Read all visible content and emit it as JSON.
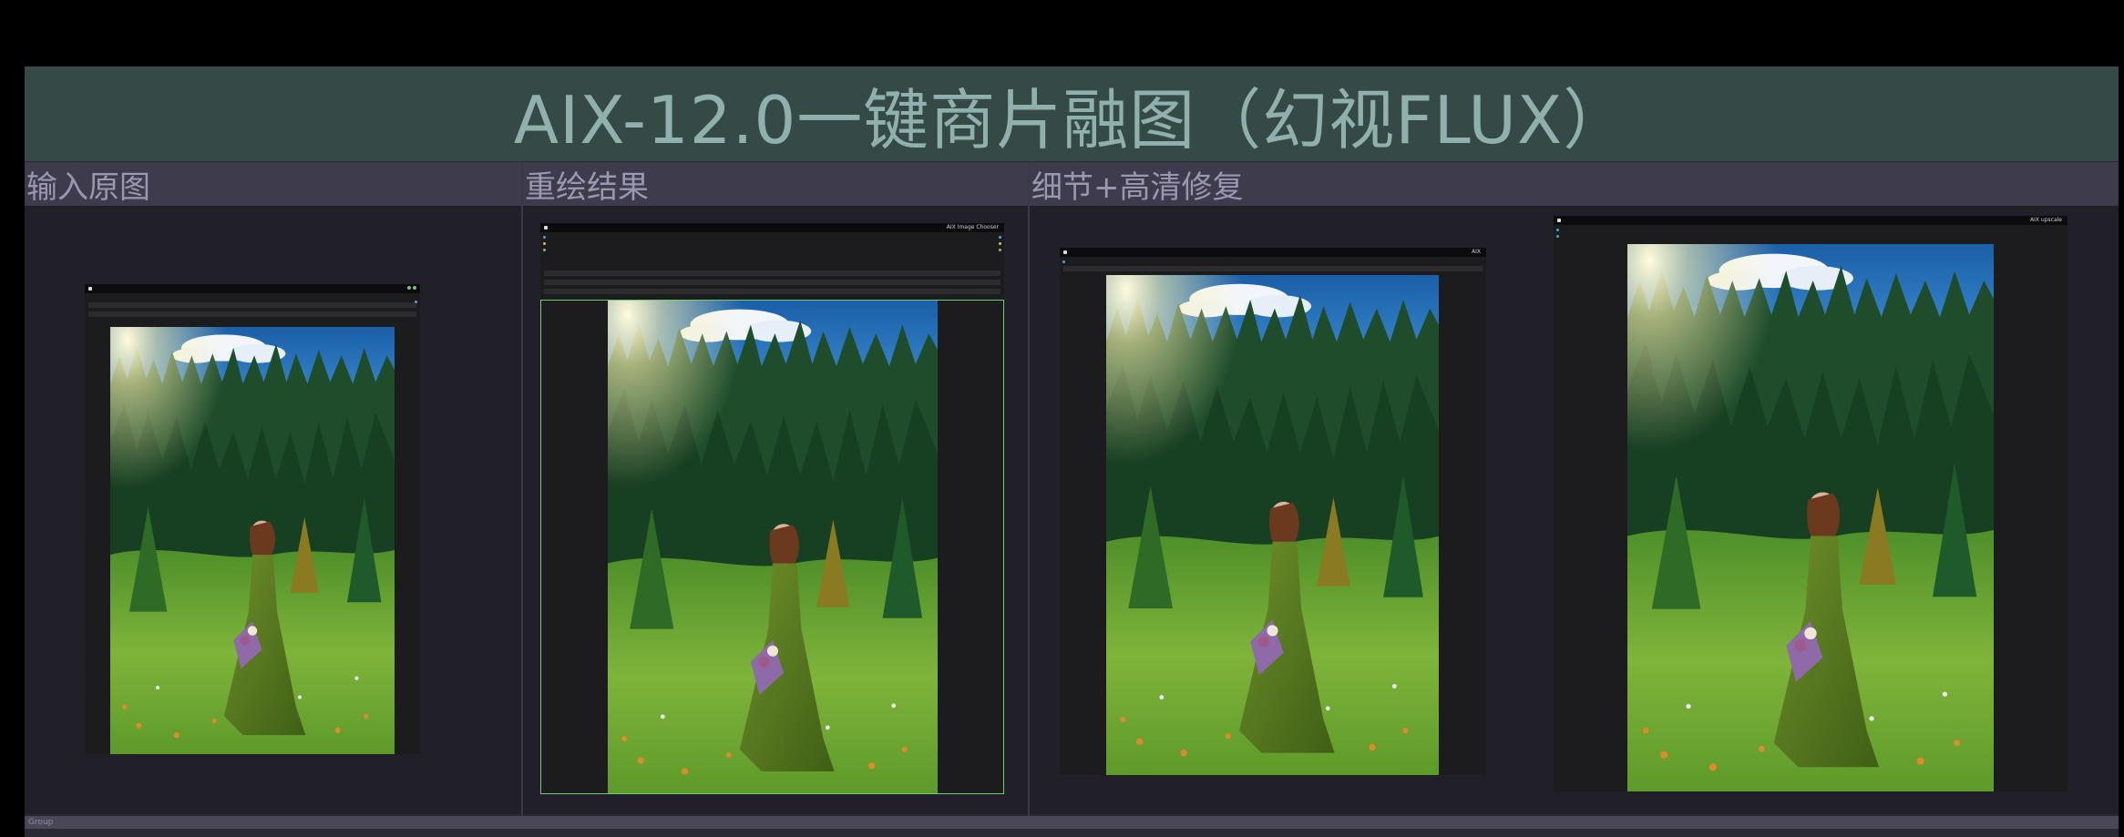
{
  "header": {
    "title": "AIX-12.0一键商片融图（幻视FLUX）"
  },
  "sections": [
    {
      "label": "输入原图"
    },
    {
      "label": "重绘结果"
    },
    {
      "label": "细节+高清修复"
    }
  ],
  "nodes": {
    "input_preview": {
      "header_label": ""
    },
    "redraw_preview": {
      "header_label": "AIX Image Chooser"
    },
    "detail_preview_1": {
      "header_label": "AIX"
    },
    "detail_preview_2": {
      "header_label": "AIX upscale"
    }
  },
  "footer": {
    "group_label": "Group"
  },
  "colors": {
    "background": "#000000",
    "title_bar": "#354a47",
    "title_text": "#8fb0ad",
    "section_header": "#3d3b4c",
    "section_text": "#9a98b0",
    "panel": "#212028",
    "node": "#1c1c1e",
    "selection": "#6fcf6f"
  }
}
